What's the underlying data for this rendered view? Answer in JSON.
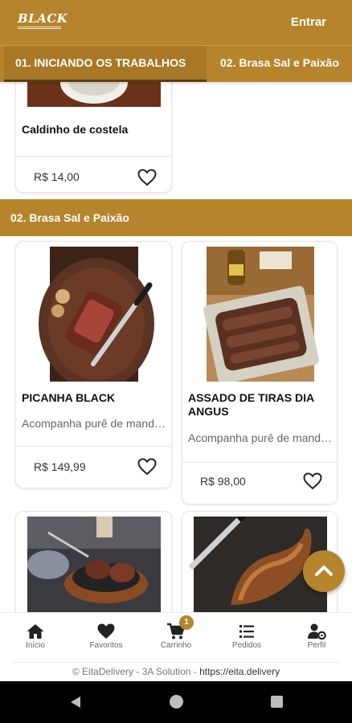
{
  "header": {
    "logo_text": "BLACK",
    "login_label": "Entrar"
  },
  "tabs": [
    {
      "label": "01. INICIANDO OS TRABALHOS",
      "active": true
    },
    {
      "label": "02. Brasa Sal e Paixão",
      "active": false
    }
  ],
  "section1": {
    "items": [
      {
        "name": "Caldinho de costela",
        "price": "R$ 14,00"
      }
    ]
  },
  "section2": {
    "title": "02. Brasa Sal e Paixão",
    "items": [
      {
        "name": "PICANHA BLACK",
        "description": "Acompanha purê de mandioquinha",
        "price": "R$ 149,99"
      },
      {
        "name": "ASSADO DE TIRAS DIA ANGUS",
        "description": "Acompanha purê de mandioquinha",
        "price": "R$ 98,00"
      }
    ]
  },
  "nav": {
    "items": [
      {
        "label": "Início",
        "icon": "home-icon"
      },
      {
        "label": "Favoritos",
        "icon": "heart-icon"
      },
      {
        "label": "Carrinho",
        "icon": "cart-icon",
        "badge": "1"
      },
      {
        "label": "Pedidos",
        "icon": "list-icon"
      },
      {
        "label": "Perfil",
        "icon": "user-gear-icon"
      }
    ]
  },
  "footer": {
    "text": "© EitaDelivery - 3A Solution - ",
    "url": "https://eita.delivery"
  },
  "colors": {
    "brand": "#b6842c",
    "text": "#111111",
    "muted": "#666666"
  }
}
